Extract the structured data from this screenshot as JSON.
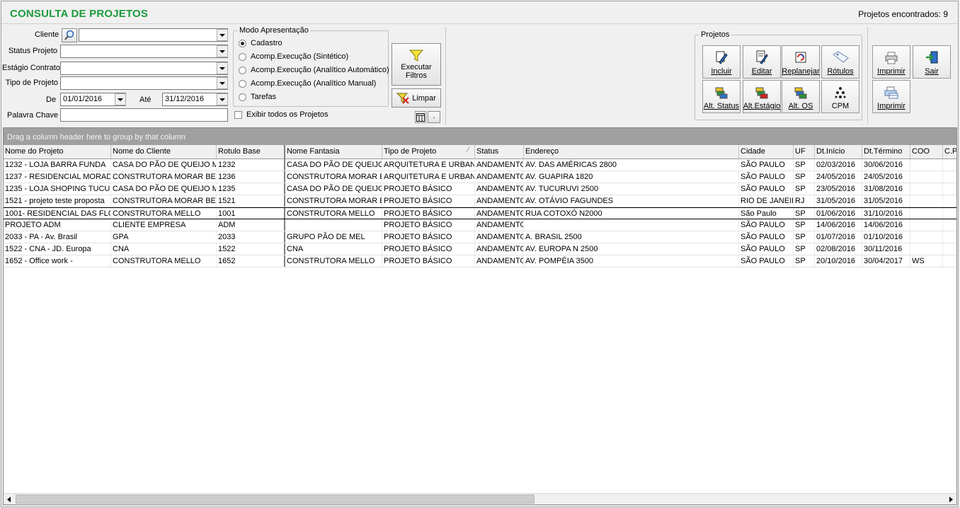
{
  "header": {
    "title": "CONSULTA DE PROJETOS",
    "count_label": "Projetos encontrados: 9"
  },
  "filters": {
    "cliente_label": "Cliente",
    "cliente_value": "",
    "status_label": "Status Projeto",
    "estagio_label": "Estágio Contrato",
    "tipo_label": "Tipo de Projeto",
    "de_label": "De",
    "de_value": "01/01/2016",
    "ate_label": "Até",
    "ate_value": "31/12/2016",
    "palavra_label": "Palavra Chave",
    "palavra_value": ""
  },
  "modo": {
    "legend": "Modo Apresentação",
    "options": [
      "Cadastro",
      "Acomp.Execução (Sintético)",
      "Acomp.Execução (Analítico Automático)",
      "Acomp.Execução (Analítico Manual)",
      "Tarefas"
    ],
    "selected": "Cadastro",
    "exibir_todos": "Exibir todos os Projetos"
  },
  "actions": {
    "executar": "Executar Filtros",
    "executar_l1": "Executar",
    "executar_l2": "Filtros",
    "limpar": "Limpar",
    "dot": "."
  },
  "projetos": {
    "legend": "Projetos",
    "buttons": [
      "Incluir",
      "Editar",
      "Replanejar",
      "Rótulos",
      "Alt. Status",
      "Alt.Estágio",
      "Alt. OS",
      "CPM"
    ]
  },
  "tools": {
    "imprimir1": "Imprimir",
    "sair": "Sair",
    "imprimir2": "Imprimir"
  },
  "grid": {
    "group_hint": "Drag a column header here to group by that column",
    "columns": [
      "Nome do Projeto",
      "Nome do Cliente",
      "Rotulo Base",
      "Nome Fantasia",
      "Tipo de Projeto",
      "Status",
      "Endereço",
      "Cidade",
      "UF",
      "Dt.Início",
      "Dt.Término",
      "COO",
      "C.P"
    ],
    "rows": [
      [
        "1232 - LOJA BARRA FUNDA",
        "CASA DO PÃO DE QUEIJO M",
        "1232",
        "CASA DO PÃO DE QUEIJO",
        "ARQUITETURA E URBAN",
        "ANDAMENTO",
        "AV. DAS AMÉRICAS 2800",
        "SÃO PAULO",
        "SP",
        "02/03/2016",
        "30/06/2016",
        "",
        ""
      ],
      [
        "1237 - RESIDENCIAL MORAD.",
        "CONSTRUTORA MORAR BE",
        "1236",
        "CONSTRUTORA MORAR E",
        "ARQUITETURA E URBAN",
        "ANDAMENTO",
        "AV. GUAPIRA 1820",
        "SÃO PAULO",
        "SP",
        "24/05/2016",
        "24/05/2016",
        "",
        ""
      ],
      [
        "1235 - LOJA SHOPING TUCUR",
        "CASA DO PÃO DE QUEIJO M",
        "1235",
        "CASA DO PÃO DE QUEIJO",
        "PROJETO BÁSICO",
        "ANDAMENTO",
        "AV. TUCURUVI 2500",
        "SÃO PAULO",
        "SP",
        "23/05/2016",
        "31/08/2016",
        "",
        ""
      ],
      [
        "1521 - projeto teste proposta",
        "CONSTRUTORA MORAR BE",
        "1521",
        "CONSTRUTORA MORAR E",
        "PROJETO BÁSICO",
        "ANDAMENTO",
        "AV. OTÁVIO FAGUNDES",
        "RIO DE JANEIR",
        "RJ",
        "31/05/2016",
        "31/05/2016",
        "",
        ""
      ],
      [
        "1001- RESIDENCIAL DAS FLO",
        "CONSTRUTORA MELLO",
        "1001",
        "CONSTRUTORA MELLO",
        "PROJETO BÁSICO",
        "ANDAMENTO",
        "RUA COTOXÓ N2000",
        "São Paulo",
        "SP",
        "01/06/2016",
        "31/10/2016",
        "",
        ""
      ],
      [
        "PROJETO ADM",
        "CLIENTE EMPRESA",
        "ADM",
        "",
        "PROJETO BÁSICO",
        "ANDAMENTO",
        "",
        "SÃO PAULO",
        "SP",
        "14/06/2016",
        "14/06/2016",
        "",
        ""
      ],
      [
        "2033  - PA - Av. Brasil",
        "GPA",
        "2033",
        "GRUPO PÃO DE MEL",
        "PROJETO BÁSICO",
        "ANDAMENTO",
        "A. BRASIL 2500",
        "SÃO PAULO",
        "SP",
        "01/07/2016",
        "01/10/2016",
        "",
        ""
      ],
      [
        "1522 - CNA - JD. Europa",
        "CNA",
        "1522",
        "CNA",
        "PROJETO BÁSICO",
        "ANDAMENTO",
        "AV. EUROPA N 2500",
        "SÃO PAULO",
        "SP",
        "02/08/2016",
        "30/11/2016",
        "",
        ""
      ],
      [
        "1652 - Office work -",
        "CONSTRUTORA MELLO",
        "1652",
        "CONSTRUTORA MELLO",
        "PROJETO BÁSICO",
        "ANDAMENTO",
        "AV. POMPÉIA 3500",
        "SÃO PAULO",
        "SP",
        "20/10/2016",
        "30/04/2017",
        "WS",
        ""
      ]
    ],
    "selected_row": 4
  }
}
